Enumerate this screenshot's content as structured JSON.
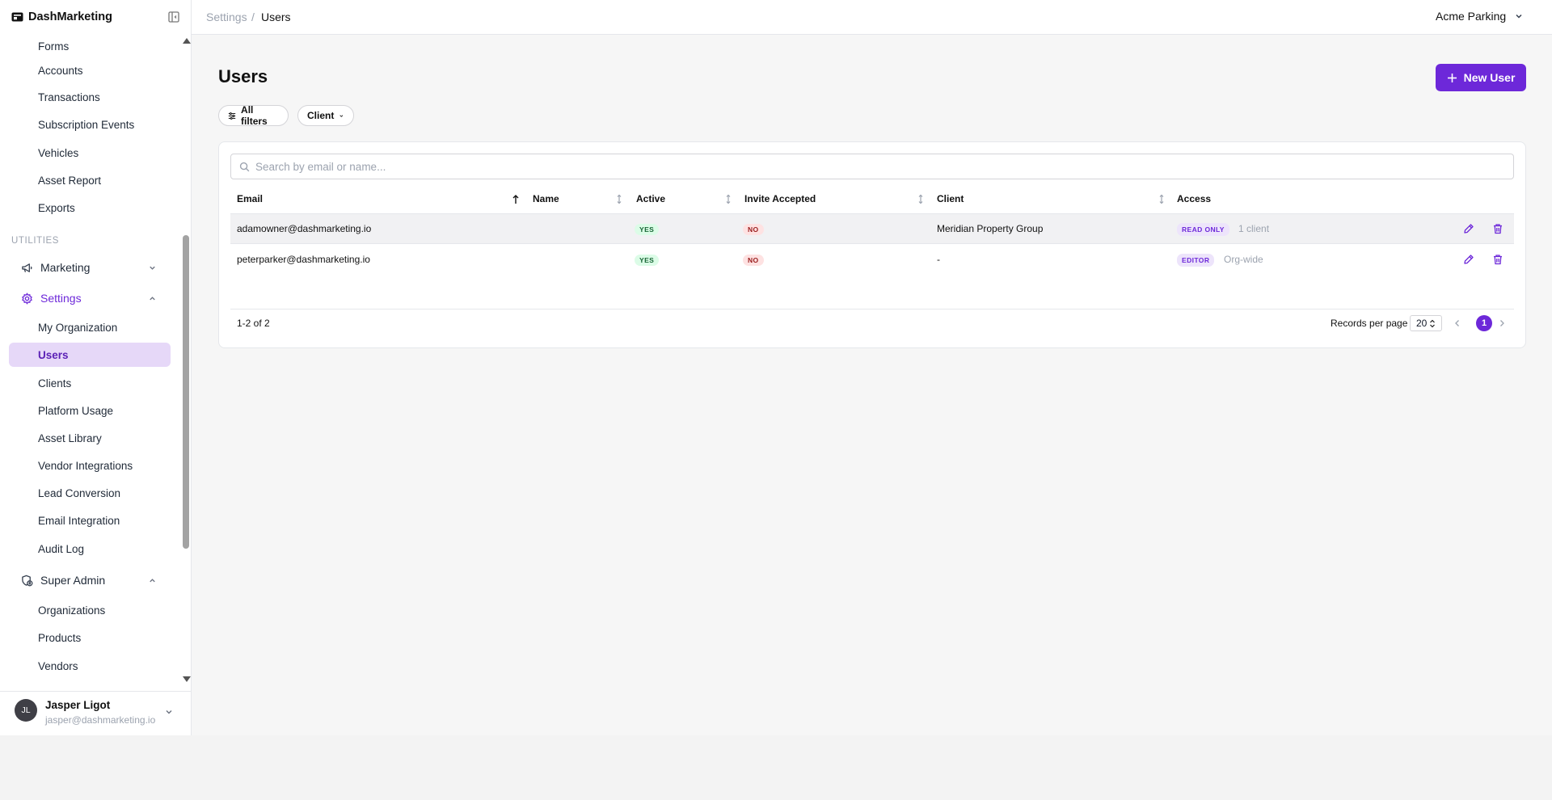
{
  "brand": {
    "name": "DashMarketing"
  },
  "sidebar": {
    "items_top": [
      {
        "label": "Forms"
      },
      {
        "label": "Accounts"
      },
      {
        "label": "Transactions"
      },
      {
        "label": "Subscription Events"
      },
      {
        "label": "Vehicles"
      },
      {
        "label": "Asset Report"
      },
      {
        "label": "Exports"
      }
    ],
    "section_label": "UTILITIES",
    "marketing": {
      "label": "Marketing",
      "icon": "megaphone-icon",
      "expanded": false
    },
    "settings": {
      "label": "Settings",
      "icon": "gear-icon",
      "expanded": true,
      "items": [
        {
          "label": "My Organization"
        },
        {
          "label": "Users",
          "active": true
        },
        {
          "label": "Clients"
        },
        {
          "label": "Platform Usage"
        },
        {
          "label": "Asset Library"
        },
        {
          "label": "Vendor Integrations"
        },
        {
          "label": "Lead Conversion"
        },
        {
          "label": "Email Integration"
        },
        {
          "label": "Audit Log"
        }
      ]
    },
    "super_admin": {
      "label": "Super Admin",
      "icon": "shield-lock-icon",
      "expanded": true,
      "items": [
        {
          "label": "Organizations"
        },
        {
          "label": "Products"
        },
        {
          "label": "Vendors"
        }
      ]
    },
    "user": {
      "initials": "JL",
      "name": "Jasper Ligot",
      "email": "jasper@dashmarketing.io"
    }
  },
  "topbar": {
    "breadcrumb": {
      "parent": "Settings",
      "separator": "/",
      "current": "Users"
    },
    "organization": "Acme Parking"
  },
  "main": {
    "title": "Users",
    "new_button": "New User",
    "filters": {
      "all": "All filters",
      "client": "Client"
    },
    "search_placeholder": "Search by email or name...",
    "columns": {
      "email": "Email",
      "name": "Name",
      "active": "Active",
      "invite": "Invite Accepted",
      "client": "Client",
      "access": "Access"
    },
    "sort": {
      "column": "email",
      "direction": "ascending"
    },
    "rows": [
      {
        "email": "adamowner@dashmarketing.io",
        "name": "",
        "active": "YES",
        "invite": "NO",
        "client": "Meridian Property Group",
        "role": "READ ONLY",
        "access_note": "1 client"
      },
      {
        "email": "peterparker@dashmarketing.io",
        "name": "",
        "active": "YES",
        "invite": "NO",
        "client": "-",
        "role": "EDITOR",
        "access_note": "Org-wide"
      }
    ],
    "footer": {
      "count": "1-2 of 2",
      "records_per_page_label": "Records per page",
      "records_per_page": "20",
      "current_page": "1"
    }
  },
  "colors": {
    "accent": "#6d28d9",
    "active_nav_bg": "#e6d8f8",
    "yes_bg": "#dcfce7",
    "no_bg": "#fee2e2"
  }
}
